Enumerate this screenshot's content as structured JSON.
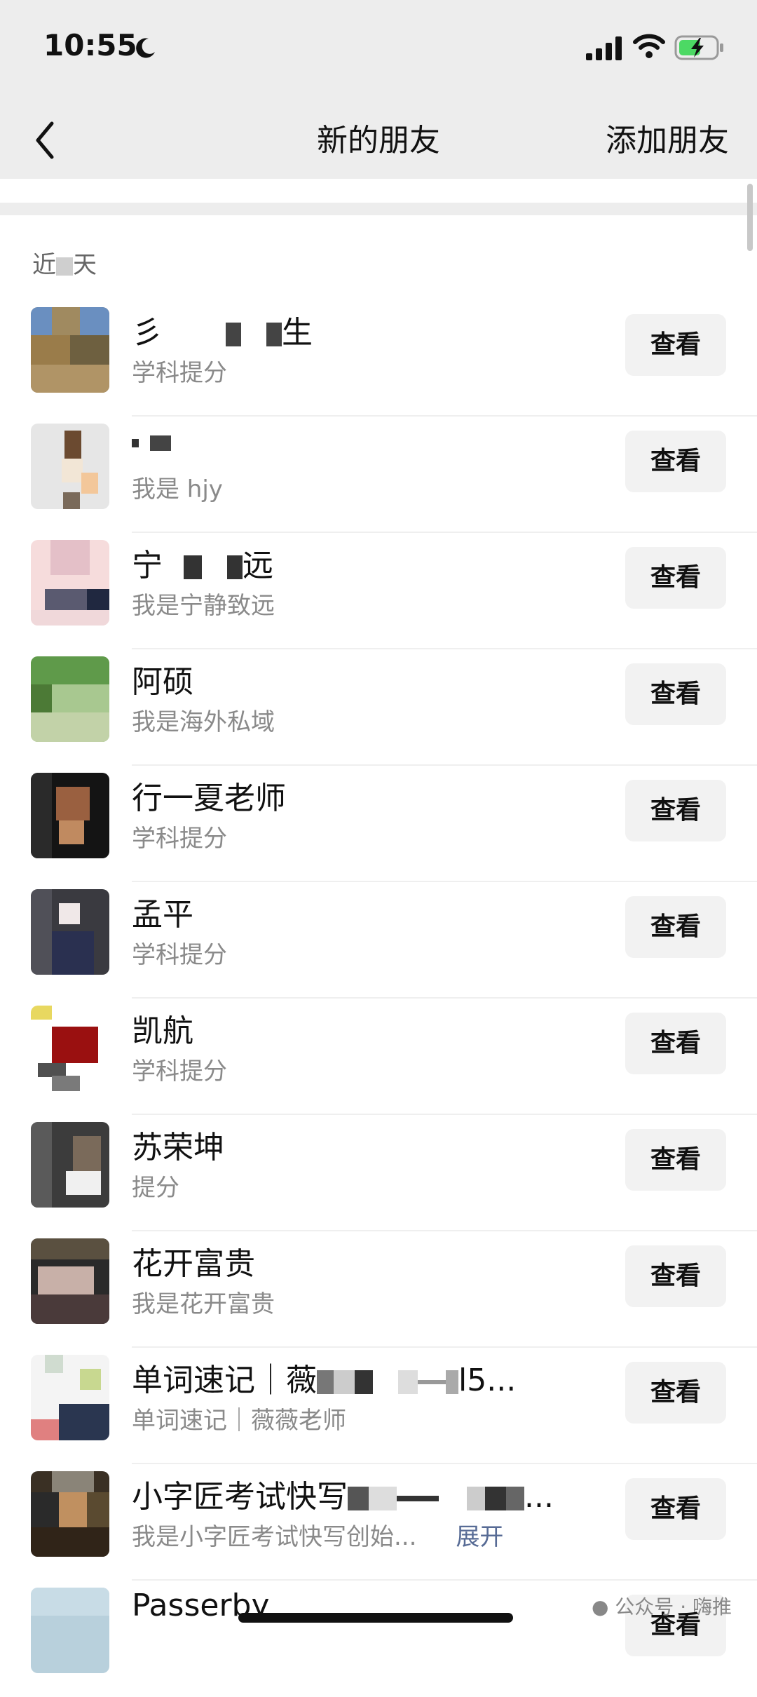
{
  "status_bar": {
    "time": "10:55",
    "icons": [
      "moon-icon",
      "signal-icon",
      "wifi-icon",
      "battery-charging-icon"
    ]
  },
  "nav": {
    "back_icon": "chevron-left-icon",
    "title": "新的朋友",
    "action": "添加朋友"
  },
  "section": {
    "label_start": "近",
    "label_end": "天"
  },
  "requests": [
    {
      "name": "彡",
      "name_tail": "生",
      "subtitle": "学科提分",
      "button": "查看"
    },
    {
      "name": "",
      "subtitle": "我是 hjy",
      "button": "查看"
    },
    {
      "name": "宁",
      "name_tail": "远",
      "subtitle": "我是宁静致远",
      "button": "查看"
    },
    {
      "name": "阿硕",
      "subtitle": "我是海外私域",
      "button": "查看"
    },
    {
      "name": "行一夏老师",
      "subtitle": "学科提分",
      "button": "查看"
    },
    {
      "name": "孟平",
      "subtitle": "学科提分",
      "button": "查看"
    },
    {
      "name": "凯航",
      "subtitle": "学科提分",
      "button": "查看"
    },
    {
      "name": "苏荣坤",
      "subtitle": "提分",
      "button": "查看"
    },
    {
      "name": "花开富贵",
      "subtitle": "我是花开富贵",
      "button": "查看"
    },
    {
      "name": "单词速记｜薇",
      "name_tail": "l5...",
      "subtitle": "单词速记｜薇薇老师",
      "button": "查看"
    },
    {
      "name": "小字匠考试快写",
      "name_tail": "...",
      "subtitle": "我是小字匠考试快写创始...",
      "expand": "展开",
      "button": "查看"
    },
    {
      "name": "Passerby",
      "subtitle": "",
      "button": "查看"
    }
  ],
  "watermark": "公众号 · 嗨推",
  "colors": {
    "nav_background": "#ededed",
    "link_blue": "#576b95",
    "button_background": "#f2f2f2"
  }
}
